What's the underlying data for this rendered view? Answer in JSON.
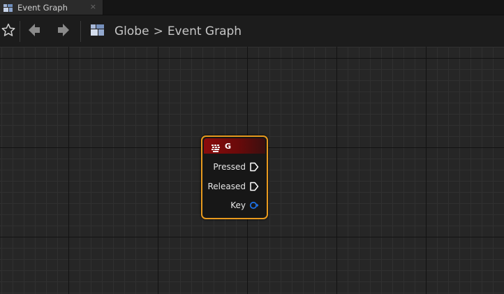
{
  "tab": {
    "title": "Event Graph",
    "close_glyph": "×",
    "icon": "blueprint-icon"
  },
  "toolbar": {
    "favorite_icon": "star-icon",
    "back_icon": "arrow-left-icon",
    "forward_icon": "arrow-right-icon",
    "blueprint_icon": "blueprint-icon"
  },
  "breadcrumb": {
    "items": [
      "Globe",
      "Event Graph"
    ],
    "separator": ">"
  },
  "node": {
    "title": "G",
    "icon": "keyboard-icon",
    "pins": [
      "Pressed",
      "Released",
      "Key"
    ],
    "colors": {
      "border": "#e89a1e",
      "header": "#8a0c0c",
      "key_pin": "#1f6fe0"
    }
  }
}
